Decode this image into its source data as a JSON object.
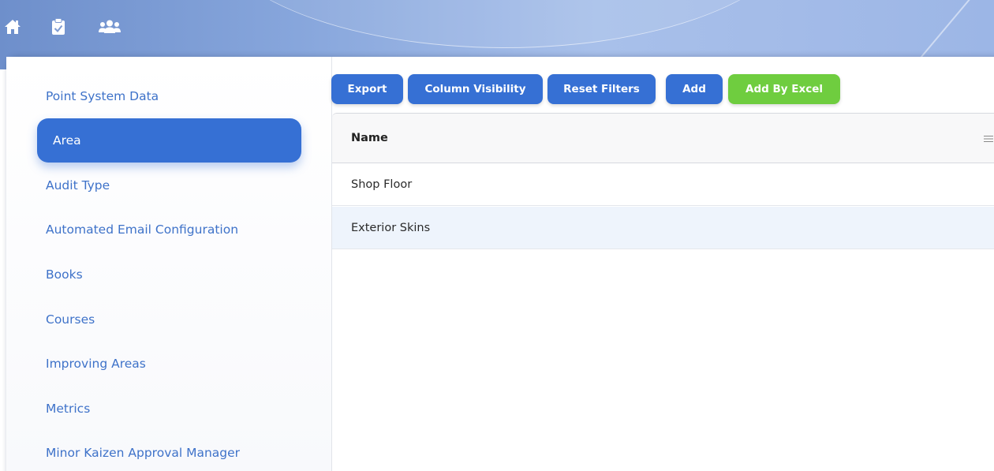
{
  "sidebar": {
    "items": [
      {
        "label": "Point System Data",
        "active": false
      },
      {
        "label": "Area",
        "active": true
      },
      {
        "label": "Audit Type",
        "active": false
      },
      {
        "label": "Automated Email Configuration",
        "active": false
      },
      {
        "label": "Books",
        "active": false
      },
      {
        "label": "Courses",
        "active": false
      },
      {
        "label": "Improving Areas",
        "active": false
      },
      {
        "label": "Metrics",
        "active": false
      },
      {
        "label": "Minor Kaizen Approval Manager",
        "active": false
      }
    ]
  },
  "toolbar": {
    "export_label": "Export",
    "column_visibility_label": "Column Visibility",
    "reset_filters_label": "Reset Filters",
    "add_label": "Add",
    "add_by_excel_label": "Add By Excel"
  },
  "grid": {
    "columns": [
      "Name"
    ],
    "rows": [
      {
        "name": "Shop Floor"
      },
      {
        "name": "Exterior Skins"
      }
    ]
  },
  "icons": {
    "home": "home-icon",
    "clipboard": "clipboard-check-icon",
    "users": "users-icon",
    "column_menu": "hamburger-menu-icon"
  },
  "colors": {
    "primary": "#3670d4",
    "success": "#6fcd3f",
    "link": "#3e72c9"
  }
}
